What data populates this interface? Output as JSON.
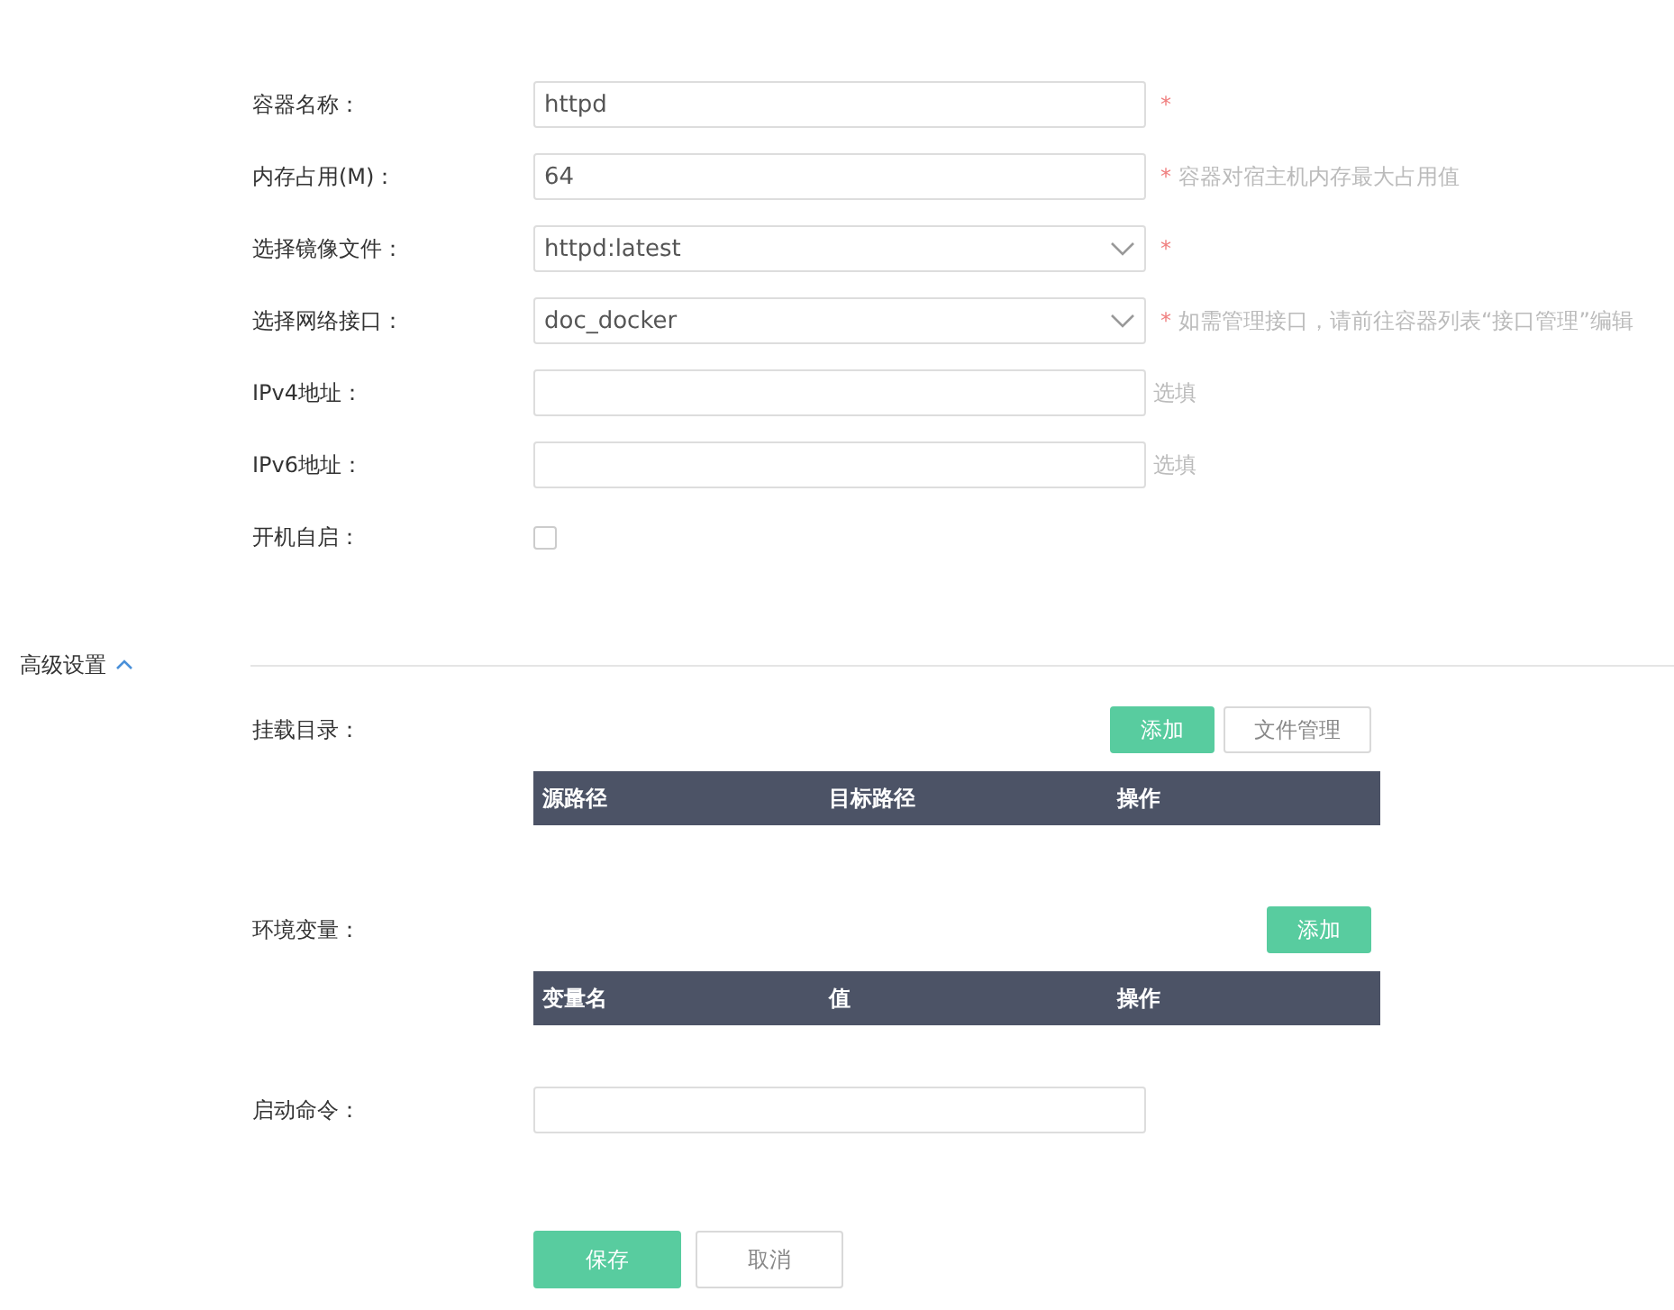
{
  "fields": [
    {
      "kind": "text",
      "label": "容器名称：",
      "value": "httpd",
      "required_mark": "*"
    },
    {
      "kind": "text",
      "label": "内存占用(M)：",
      "value": "64",
      "required_mark": "*",
      "hint": "容器对宿主机内存最大占用值"
    },
    {
      "kind": "select",
      "label": "选择镜像文件：",
      "value": "httpd:latest",
      "required_mark": "*"
    },
    {
      "kind": "select",
      "label": "选择网络接口：",
      "value": "doc_docker",
      "required_mark": "*",
      "hint": "如需管理接口，请前往容器列表“接口管理”编辑"
    },
    {
      "kind": "text",
      "label": "IPv4地址：",
      "hint": "选填"
    },
    {
      "kind": "text",
      "label": "IPv6地址：",
      "hint": "选填"
    },
    {
      "kind": "checkbox",
      "label": "开机自启：",
      "checked": false
    }
  ],
  "advanced": {
    "title": "高级设置",
    "expanded": true,
    "sections": [
      {
        "label": "挂载目录：",
        "buttons": [
          {
            "label": "添加",
            "kind": "primary"
          },
          {
            "label": "文件管理",
            "kind": "default"
          }
        ],
        "columns": [
          "源路径",
          "目标路径",
          "操作"
        ]
      },
      {
        "label": "环境变量：",
        "buttons": [
          {
            "label": "添加",
            "kind": "primary"
          }
        ],
        "columns": [
          "变量名",
          "值",
          "操作"
        ]
      }
    ],
    "command": {
      "label": "启动命令："
    }
  },
  "actions": [
    {
      "label": "保存",
      "kind": "primary"
    },
    {
      "label": "取消",
      "kind": "default"
    }
  ]
}
